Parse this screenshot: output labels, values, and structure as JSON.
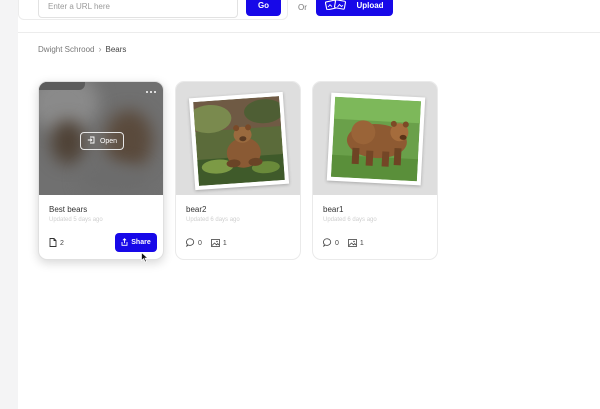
{
  "toolbar": {
    "url_placeholder": "Enter a URL here",
    "go_label": "Go",
    "or_label": "Or",
    "upload_label": "Upload"
  },
  "breadcrumb": {
    "parent": "Dwight Schrood",
    "current": "Bears"
  },
  "collections": [
    {
      "title": "Best bears",
      "updated": "Updated 5 days ago",
      "file_count": "2",
      "open_label": "Open",
      "share_label": "Share"
    },
    {
      "title": "bear2",
      "updated": "Updated 6 days ago",
      "comment_count": "0",
      "image_count": "1"
    },
    {
      "title": "bear1",
      "updated": "Updated 6 days ago",
      "comment_count": "0",
      "image_count": "1"
    }
  ],
  "colors": {
    "accent": "#1708e8",
    "thumb_bg": "#dedede",
    "blurred_cover": "#707070"
  },
  "icons": {
    "upload": "upload-photos-icon",
    "open": "open-in-icon",
    "share": "share-icon",
    "file": "file-icon",
    "comment": "comment-icon",
    "image": "image-icon",
    "more": "more-options-icon",
    "pointer": "cursor-pointer-icon"
  }
}
